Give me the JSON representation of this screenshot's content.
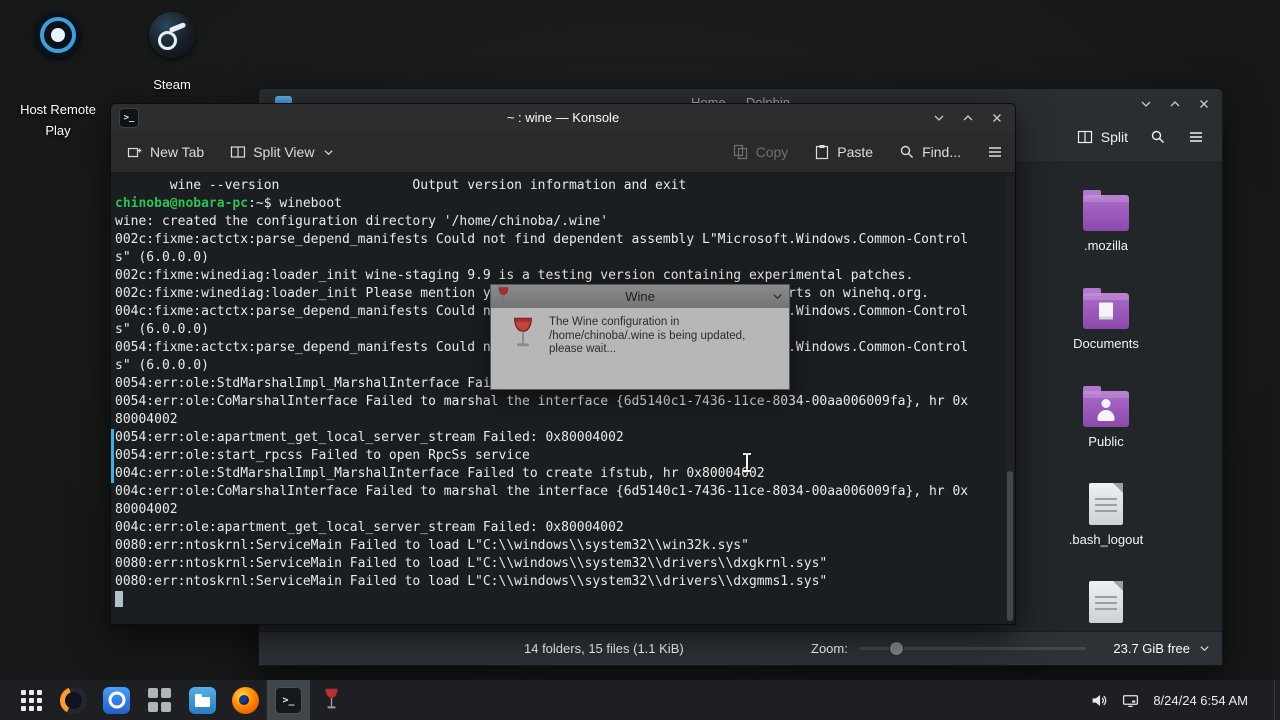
{
  "desktop": {
    "icons": [
      {
        "label": "Host Remote Play"
      },
      {
        "label": "Steam"
      }
    ]
  },
  "dolphin": {
    "title": "Home — Dolphin",
    "toolbar": {
      "split_label": "Split"
    },
    "files": [
      {
        "name": ".mozilla",
        "type": "folder"
      },
      {
        "name": "Documents",
        "type": "folder-docs"
      },
      {
        "name": "Public",
        "type": "folder-public"
      },
      {
        "name": ".bash_logout",
        "type": "file"
      },
      {
        "name": "",
        "type": "file"
      }
    ],
    "statusbar": {
      "summary": "14 folders, 15 files (1.1 KiB)",
      "zoom_label": "Zoom:",
      "free_space": "23.7 GiB free"
    }
  },
  "konsole": {
    "title": "~ : wine — Konsole",
    "toolbar": {
      "new_tab": "New Tab",
      "split_view": "Split View",
      "copy": "Copy",
      "paste": "Paste",
      "find": "Find..."
    },
    "terminal": {
      "lines": [
        "       wine --version                 Output version information and exit",
        [
          {
            "t": "chinoba@nobara-pc",
            "c": "#2fc054",
            "b": true
          },
          {
            "t": ":~$ wineboot"
          }
        ],
        "wine: created the configuration directory '/home/chinoba/.wine'",
        "002c:fixme:actctx:parse_depend_manifests Could not find dependent assembly L\"Microsoft.Windows.Common-Control",
        "s\" (6.0.0.0)",
        "002c:fixme:winediag:loader_init wine-staging 9.9 is a testing version containing experimental patches.",
        "002c:fixme:winediag:loader_init Please mention your exact version when filing bug reports on winehq.org.",
        "004c:fixme:actctx:parse_depend_manifests Could not find dependent assembly L\"Microsoft.Windows.Common-Control",
        "s\" (6.0.0.0)",
        "0054:fixme:actctx:parse_depend_manifests Could not find dependent assembly L\"Microsoft.Windows.Common-Control",
        "s\" (6.0.0.0)",
        "0054:err:ole:StdMarshalImpl_MarshalInterface Failed to create ifstub, hr 0x80004002",
        "0054:err:ole:CoMarshalInterface Failed to marshal the interface {6d5140c1-7436-11ce-8034-00aa006009fa}, hr 0x",
        "80004002",
        "0054:err:ole:apartment_get_local_server_stream Failed: 0x80004002",
        "0054:err:ole:start_rpcss Failed to open RpcSs service",
        "004c:err:ole:StdMarshalImpl_MarshalInterface Failed to create ifstub, hr 0x80004002",
        "004c:err:ole:CoMarshalInterface Failed to marshal the interface {6d5140c1-7436-11ce-8034-00aa006009fa}, hr 0x",
        "80004002",
        "004c:err:ole:apartment_get_local_server_stream Failed: 0x80004002",
        "0080:err:ntoskrnl:ServiceMain Failed to load L\"C:\\\\windows\\\\system32\\\\win32k.sys\"",
        "0080:err:ntoskrnl:ServiceMain Failed to load L\"C:\\\\windows\\\\system32\\\\drivers\\\\dxgkrnl.sys\"",
        "0080:err:ntoskrnl:ServiceMain Failed to load L\"C:\\\\windows\\\\system32\\\\drivers\\\\dxgmms1.sys\""
      ]
    }
  },
  "wine_dialog": {
    "title": "Wine",
    "message_lines": [
      "The Wine configuration in",
      "/home/chinoba/.wine is being updated,",
      "please wait..."
    ]
  },
  "taskbar": {
    "clock": "8/24/24 6:54 AM",
    "icons": [
      "app-launcher-icon",
      "firefox-dark-icon",
      "blue-app-icon",
      "app-grid-icon",
      "dolphin-icon",
      "firefox-icon",
      "konsole-icon",
      "wine-icon"
    ],
    "tray_icons": [
      "volume-icon",
      "display-icon"
    ]
  },
  "colors": {
    "accent": "#3daee9",
    "prompt_green": "#2fc054",
    "folder_purple": "#9a57ba",
    "terminal_bg": "#1b1e21"
  }
}
